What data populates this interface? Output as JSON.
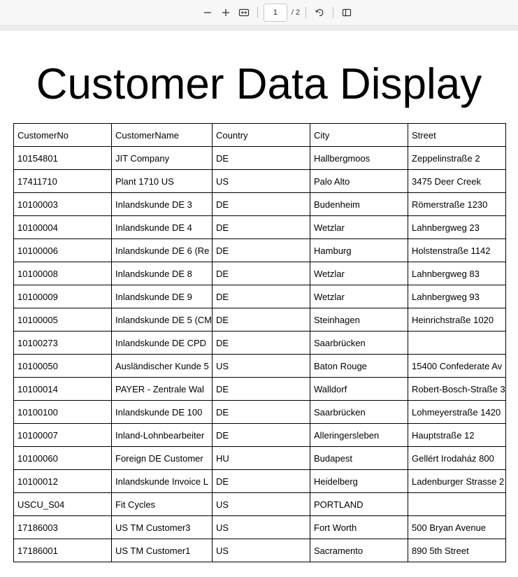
{
  "toolbar": {
    "zoom_out": "−",
    "zoom_in": "+",
    "current_page": "1",
    "page_total": "/ 2",
    "icons": [
      "minus-icon",
      "plus-icon",
      "fit-width-icon",
      "rotate-icon",
      "two-page-view-icon"
    ]
  },
  "document": {
    "title": "Customer Data Display",
    "columns": [
      "CustomerNo",
      "CustomerName",
      "Country",
      "City",
      "Street"
    ],
    "rows": [
      [
        "10154801",
        "JIT Company",
        "DE",
        "Hallbergmoos",
        "Zeppelinstraße 2"
      ],
      [
        "17411710",
        "Plant 1710 US",
        "US",
        "Palo Alto",
        "3475 Deer Creek"
      ],
      [
        "10100003",
        "Inlandskunde DE 3",
        "DE",
        "Budenheim",
        "Römerstraße 1230"
      ],
      [
        "10100004",
        "Inlandskunde DE 4",
        "DE",
        "Wetzlar",
        "Lahnbergweg 23"
      ],
      [
        "10100006",
        "Inlandskunde DE 6 (Re",
        "DE",
        "Hamburg",
        "Holstenstraße 1142"
      ],
      [
        "10100008",
        "Inlandskunde DE 8",
        "DE",
        "Wetzlar",
        "Lahnbergweg 83"
      ],
      [
        "10100009",
        "Inlandskunde DE 9",
        "DE",
        "Wetzlar",
        "Lahnbergweg 93"
      ],
      [
        "10100005",
        "Inlandskunde DE 5 (CM",
        "DE",
        "Steinhagen",
        "Heinrichstraße 1020"
      ],
      [
        "10100273",
        "Inlandskunde DE CPD",
        "DE",
        "Saarbrücken",
        ""
      ],
      [
        "10100050",
        "Ausländischer Kunde 5",
        "US",
        "Baton Rouge",
        "15400 Confederate Av"
      ],
      [
        "10100014",
        "PAYER - Zentrale Wal",
        "DE",
        "Walldorf",
        "Robert-Bosch-Straße 3"
      ],
      [
        "10100100",
        "Inlandskunde DE 100",
        "DE",
        "Saarbrücken",
        "Lohmeyerstraße 1420"
      ],
      [
        "10100007",
        "Inland-Lohnbearbeiter",
        "DE",
        "Alleringersleben",
        "Hauptstraße 12"
      ],
      [
        "10100060",
        "Foreign DE Customer",
        "HU",
        "Budapest",
        "Gellért Irodaház 800"
      ],
      [
        "10100012",
        "Inlandskunde Invoice L",
        "DE",
        "Heidelberg",
        "Ladenburger Strasse 2"
      ],
      [
        "USCU_S04",
        "Fit Cycles",
        "US",
        "PORTLAND",
        ""
      ],
      [
        "17186003",
        "US TM Customer3",
        "US",
        "Fort Worth",
        "500 Bryan Avenue"
      ],
      [
        "17186001",
        "US TM Customer1",
        "US",
        "Sacramento",
        "890 5th Street"
      ]
    ]
  }
}
